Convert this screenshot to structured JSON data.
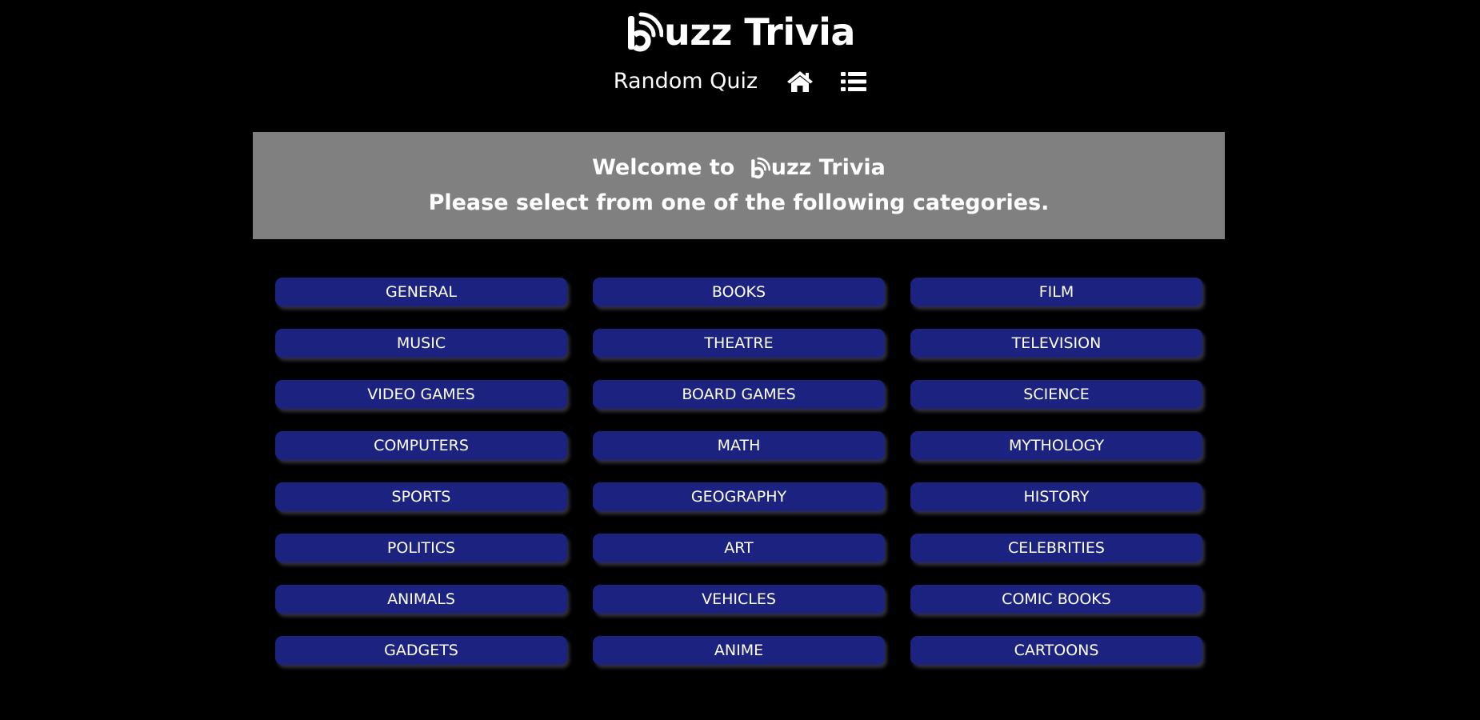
{
  "brand": {
    "logo_icon": "buzz-b-logo-icon",
    "title_rest": "uzz Trivia"
  },
  "nav": {
    "random_quiz_label": "Random Quiz",
    "home_icon": "home-icon",
    "list_icon": "list-icon"
  },
  "banner": {
    "welcome_prefix": "Welcome to ",
    "brand_rest": "uzz Trivia",
    "instruction": "Please select from one of the following categories.",
    "background_color": "#808080"
  },
  "colors": {
    "page_background": "#000000",
    "button_background": "#1c2280",
    "text": "#ffffff"
  },
  "categories": [
    "GENERAL",
    "BOOKS",
    "FILM",
    "MUSIC",
    "THEATRE",
    "TELEVISION",
    "VIDEO GAMES",
    "BOARD GAMES",
    "SCIENCE",
    "COMPUTERS",
    "MATH",
    "MYTHOLOGY",
    "SPORTS",
    "GEOGRAPHY",
    "HISTORY",
    "POLITICS",
    "ART",
    "CELEBRITIES",
    "ANIMALS",
    "VEHICLES",
    "COMIC BOOKS",
    "GADGETS",
    "ANIME",
    "CARTOONS"
  ]
}
